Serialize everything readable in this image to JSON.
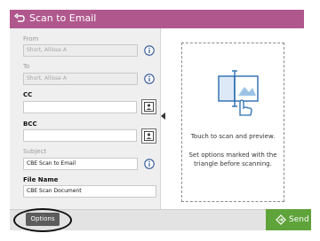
{
  "header": {
    "title": "Scan to Email",
    "back_icon": "back-arrow-icon",
    "color": "#b0588e"
  },
  "form": {
    "from": {
      "label": "From",
      "value": "Short, Allisse A"
    },
    "to": {
      "label": "To",
      "value": "Short, Allisse A"
    },
    "cc": {
      "label": "CC",
      "value": ""
    },
    "bcc": {
      "label": "BCC",
      "value": ""
    },
    "subject": {
      "label": "Subject",
      "value": "CBE Scan to Email"
    },
    "file_name": {
      "label": "File Name",
      "value": "CBE Scan Document"
    }
  },
  "preview": {
    "caption": "Touch to scan and preview.",
    "hint": "Set options marked with the triangle before scanning.",
    "icon": "touch-scan-icon"
  },
  "footer": {
    "options_label": "Options",
    "send_label": "Send",
    "send_color": "#5fa33b"
  }
}
